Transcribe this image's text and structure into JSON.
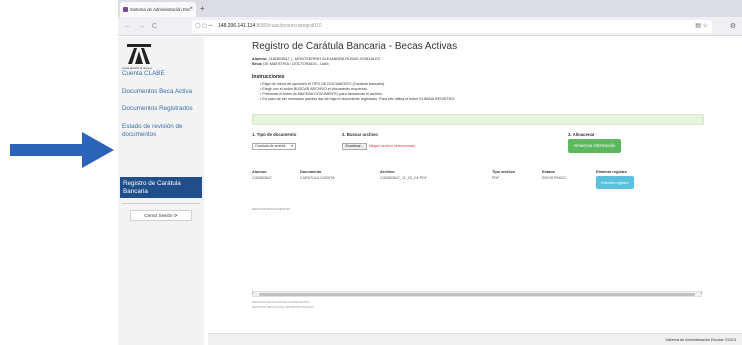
{
  "browser": {
    "tab_title": "Sistema de Administración Esc",
    "tab_close": "×",
    "new_tab": "+",
    "url_host": "148.206.141.114",
    "url_path": ":8080/cuac/pcarecustegist010",
    "back": "←",
    "forward": "→",
    "reload": "C",
    "bookmark_icon": "☆",
    "reader_icon": "▤",
    "menu_icon": "⚙"
  },
  "sidebar": {
    "logo_caption": "Casa abierta al tiempo",
    "items": [
      {
        "label": "Cuenta CLABE"
      },
      {
        "label": "Documentos Beca Activa"
      },
      {
        "label": "Documentos Registrados"
      },
      {
        "label": "Estado de revisión de documentos"
      }
    ],
    "active_item": "Registro de Carátula Bancaria",
    "logout_label": "Cerrar Sesión",
    "logout_icon": "⟳"
  },
  "main": {
    "title": "Registro de Carátula Bancaria - Becas Activas",
    "alumno_label": "Alumno:",
    "alumno_value": "2182803647 | - MONTSERRAT ALEJANDRA ROSAS GONZALEZ",
    "beca_label": "Beca:",
    "beca_value": "DE MAESTRÍA / DOCTORADO - UAM",
    "instructions_title": "Instrucciones",
    "instructions": [
      "• Elige de menú de opciones el TIPO DE DOCUMENTO (Carátula bancaria).",
      "• Elegir con el botón BUSCAR ARCHIVO el documento requerido.",
      "• Presionar el botón ALMACENA DOCUMENTO para almacenar el archivo.",
      "• En caso de ser necesario puedes dar de baja el documento registrado. Para ello utiliza el botón ELIMINA REGISTRO."
    ],
    "step1_label": "1. Tipo de documento",
    "step2_label": "2. Buscar archivo",
    "step3_label": "3. Almacenar",
    "select_value": "Carátula de cuenta",
    "file_button": "Examinar...",
    "file_none": "Ningún archivo seleccionado.",
    "save_button": "Almacena Información",
    "table_headers": [
      "Alumno",
      "Documento",
      "Archivo",
      "Tipo archivo",
      "Estado",
      "Eliminar registro"
    ],
    "table_row": [
      "2182803647",
      "CARÁTULA CUENTA",
      "2182803647_11_03_CA.PDF",
      "PDF",
      "REGISTRADO"
    ],
    "delete_button": "Elimina registro",
    "footnote": "REGISTRO/DOCUMENTOS",
    "ref_lines": [
      "REGISTROECOLDATAVE-2182803647011",
      "REGISTROBECASASQ-2182803647/04/2021"
    ],
    "scroll_left": "‹",
    "scroll_right": "›"
  },
  "footer": {
    "text": "Sistema de Administración Escolar  ©2013"
  }
}
